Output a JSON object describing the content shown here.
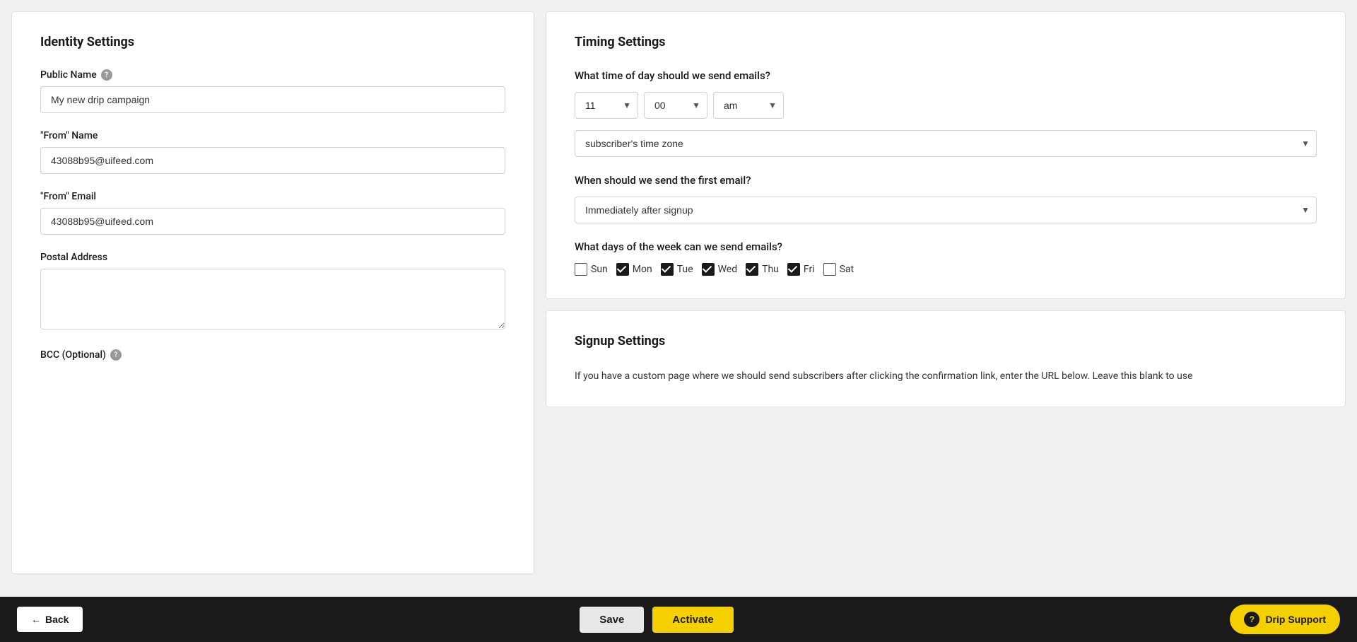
{
  "identity_settings": {
    "title": "Identity Settings",
    "public_name": {
      "label": "Public Name",
      "value": "My new drip campaign",
      "placeholder": "My new drip campaign"
    },
    "from_name": {
      "label": "\"From\" Name",
      "value": "43088b95@uifeed.com",
      "placeholder": ""
    },
    "from_email": {
      "label": "\"From\" Email",
      "value": "43088b95@uifeed.com",
      "placeholder": ""
    },
    "postal_address": {
      "label": "Postal Address",
      "value": "",
      "placeholder": ""
    },
    "bcc": {
      "label": "BCC (Optional)",
      "value": "",
      "placeholder": ""
    }
  },
  "timing_settings": {
    "title": "Timing Settings",
    "time_question": "What time of day should we send emails?",
    "hour": "11",
    "minute": "00",
    "ampm": "am",
    "timezone": "subscriber's time zone",
    "first_email_question": "When should we send the first email?",
    "first_email_value": "Immediately after signup",
    "days_question": "What days of the week can we send emails?",
    "days": [
      {
        "label": "Sun",
        "checked": false
      },
      {
        "label": "Mon",
        "checked": true
      },
      {
        "label": "Tue",
        "checked": true
      },
      {
        "label": "Wed",
        "checked": true
      },
      {
        "label": "Thu",
        "checked": true
      },
      {
        "label": "Fri",
        "checked": true
      },
      {
        "label": "Sat",
        "checked": false
      }
    ]
  },
  "signup_settings": {
    "title": "Signup Settings",
    "description": "If you have a custom page where we should send subscribers after clicking the confirmation link, enter the URL below. Leave this blank to use"
  },
  "bottom_bar": {
    "back_label": "Back",
    "save_label": "Save",
    "activate_label": "Activate",
    "support_label": "Drip Support"
  }
}
